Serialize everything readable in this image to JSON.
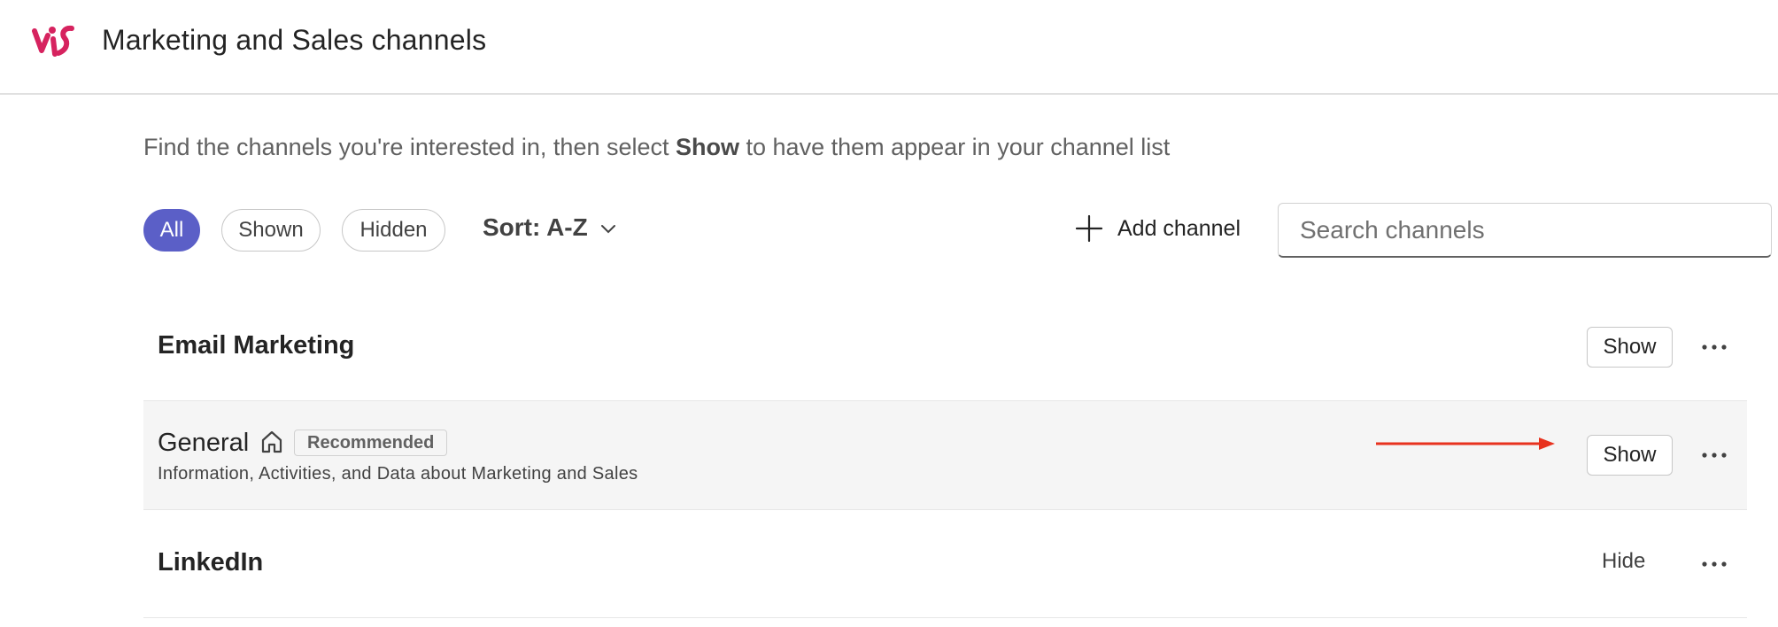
{
  "header": {
    "title": "Marketing and Sales channels",
    "logo_icon": "teams-logo-icon",
    "logo_color": "#d6235f"
  },
  "intro": {
    "before": "Find the channels you're interested in, then select ",
    "emphasis": "Show",
    "after": " to have them appear in your channel list"
  },
  "filters": {
    "items": [
      {
        "label": "All",
        "active": true
      },
      {
        "label": "Shown",
        "active": false
      },
      {
        "label": "Hidden",
        "active": false
      }
    ],
    "accent": "#5b5fc7"
  },
  "sort": {
    "label": "Sort: A-Z",
    "icon": "chevron-down-icon"
  },
  "toolbar": {
    "add_channel_label": "Add channel",
    "add_icon": "plus-icon"
  },
  "search": {
    "placeholder": "Search channels",
    "value": ""
  },
  "channels": [
    {
      "name": "Email Marketing",
      "action": "Show",
      "more_icon": "more-horizontal-icon"
    },
    {
      "name": "General",
      "icon": "home-icon",
      "badge": "Recommended",
      "description": "Information, Activities, and Data about Marketing and Sales",
      "action": "Show",
      "more_icon": "more-horizontal-icon",
      "annotation": {
        "icon": "arrow-right-icon",
        "color": "#e8321e"
      }
    },
    {
      "name": "LinkedIn",
      "action": "Hide",
      "more_icon": "more-horizontal-icon"
    }
  ]
}
